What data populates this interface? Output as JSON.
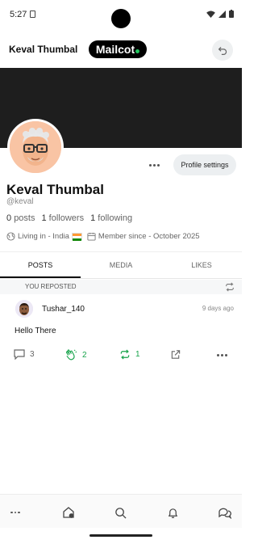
{
  "status_bar": {
    "time": "5:27"
  },
  "header": {
    "name": "Keval Thumbal",
    "brand": "Mailcot"
  },
  "profile": {
    "name": "Keval Thumbal",
    "handle": "@keval",
    "settings_label": "Profile settings",
    "stats": {
      "posts_count": "0",
      "posts_label": "posts",
      "followers_count": "1",
      "followers_label": "followers",
      "following_count": "1",
      "following_label": "following"
    },
    "location": "Living in - India",
    "member_since": "Member since - October 2025"
  },
  "tabs": [
    {
      "label": "POSTS",
      "active": true
    },
    {
      "label": "MEDIA",
      "active": false
    },
    {
      "label": "LIKES",
      "active": false
    }
  ],
  "feed": {
    "repost_label": "YOU REPOSTED",
    "post": {
      "author": "Tushar_140",
      "time": "9 days ago",
      "text": "Hello There",
      "comments": "3",
      "claps": "2",
      "reposts": "1"
    }
  },
  "bottom_nav": [
    "more-icon",
    "home-icon",
    "search-icon",
    "bell-icon",
    "chat-icon"
  ],
  "colors": {
    "accent_green": "#16a34a",
    "brand_dot": "#22c55e",
    "cover": "#1e1e1e"
  }
}
